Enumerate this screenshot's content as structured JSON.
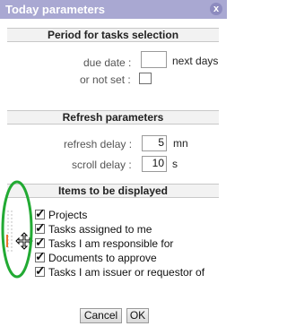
{
  "dialog": {
    "title": "Today parameters",
    "close_glyph": "x"
  },
  "period": {
    "heading": "Period for tasks selection",
    "due_date_label": "due date :",
    "due_date_value": "",
    "due_date_unit": "next days",
    "not_set_label": "or not set :",
    "not_set_checked": false
  },
  "refresh": {
    "heading": "Refresh parameters",
    "refresh_delay_label": "refresh delay :",
    "refresh_delay_value": "5",
    "refresh_delay_unit": "mn",
    "scroll_delay_label": "scroll delay :",
    "scroll_delay_value": "10",
    "scroll_delay_unit": "s"
  },
  "display": {
    "heading": "Items to be displayed",
    "items": [
      {
        "label": "Projects",
        "checked": true
      },
      {
        "label": "Tasks assigned to me",
        "checked": true
      },
      {
        "label": "Tasks I am responsible for",
        "checked": true
      },
      {
        "label": "Documents to approve",
        "checked": true
      },
      {
        "label": "Tasks I am issuer or requestor of",
        "checked": true
      }
    ]
  },
  "buttons": {
    "cancel_label": "Cancel",
    "ok_label": "OK"
  },
  "colors": {
    "titlebar": "#a9a8d2",
    "annotation": "#22aa33",
    "drag_handle": "#e8742a"
  },
  "icons": {
    "close": "close-icon",
    "check": "checkmark-icon",
    "cursor": "move-cursor-icon"
  }
}
